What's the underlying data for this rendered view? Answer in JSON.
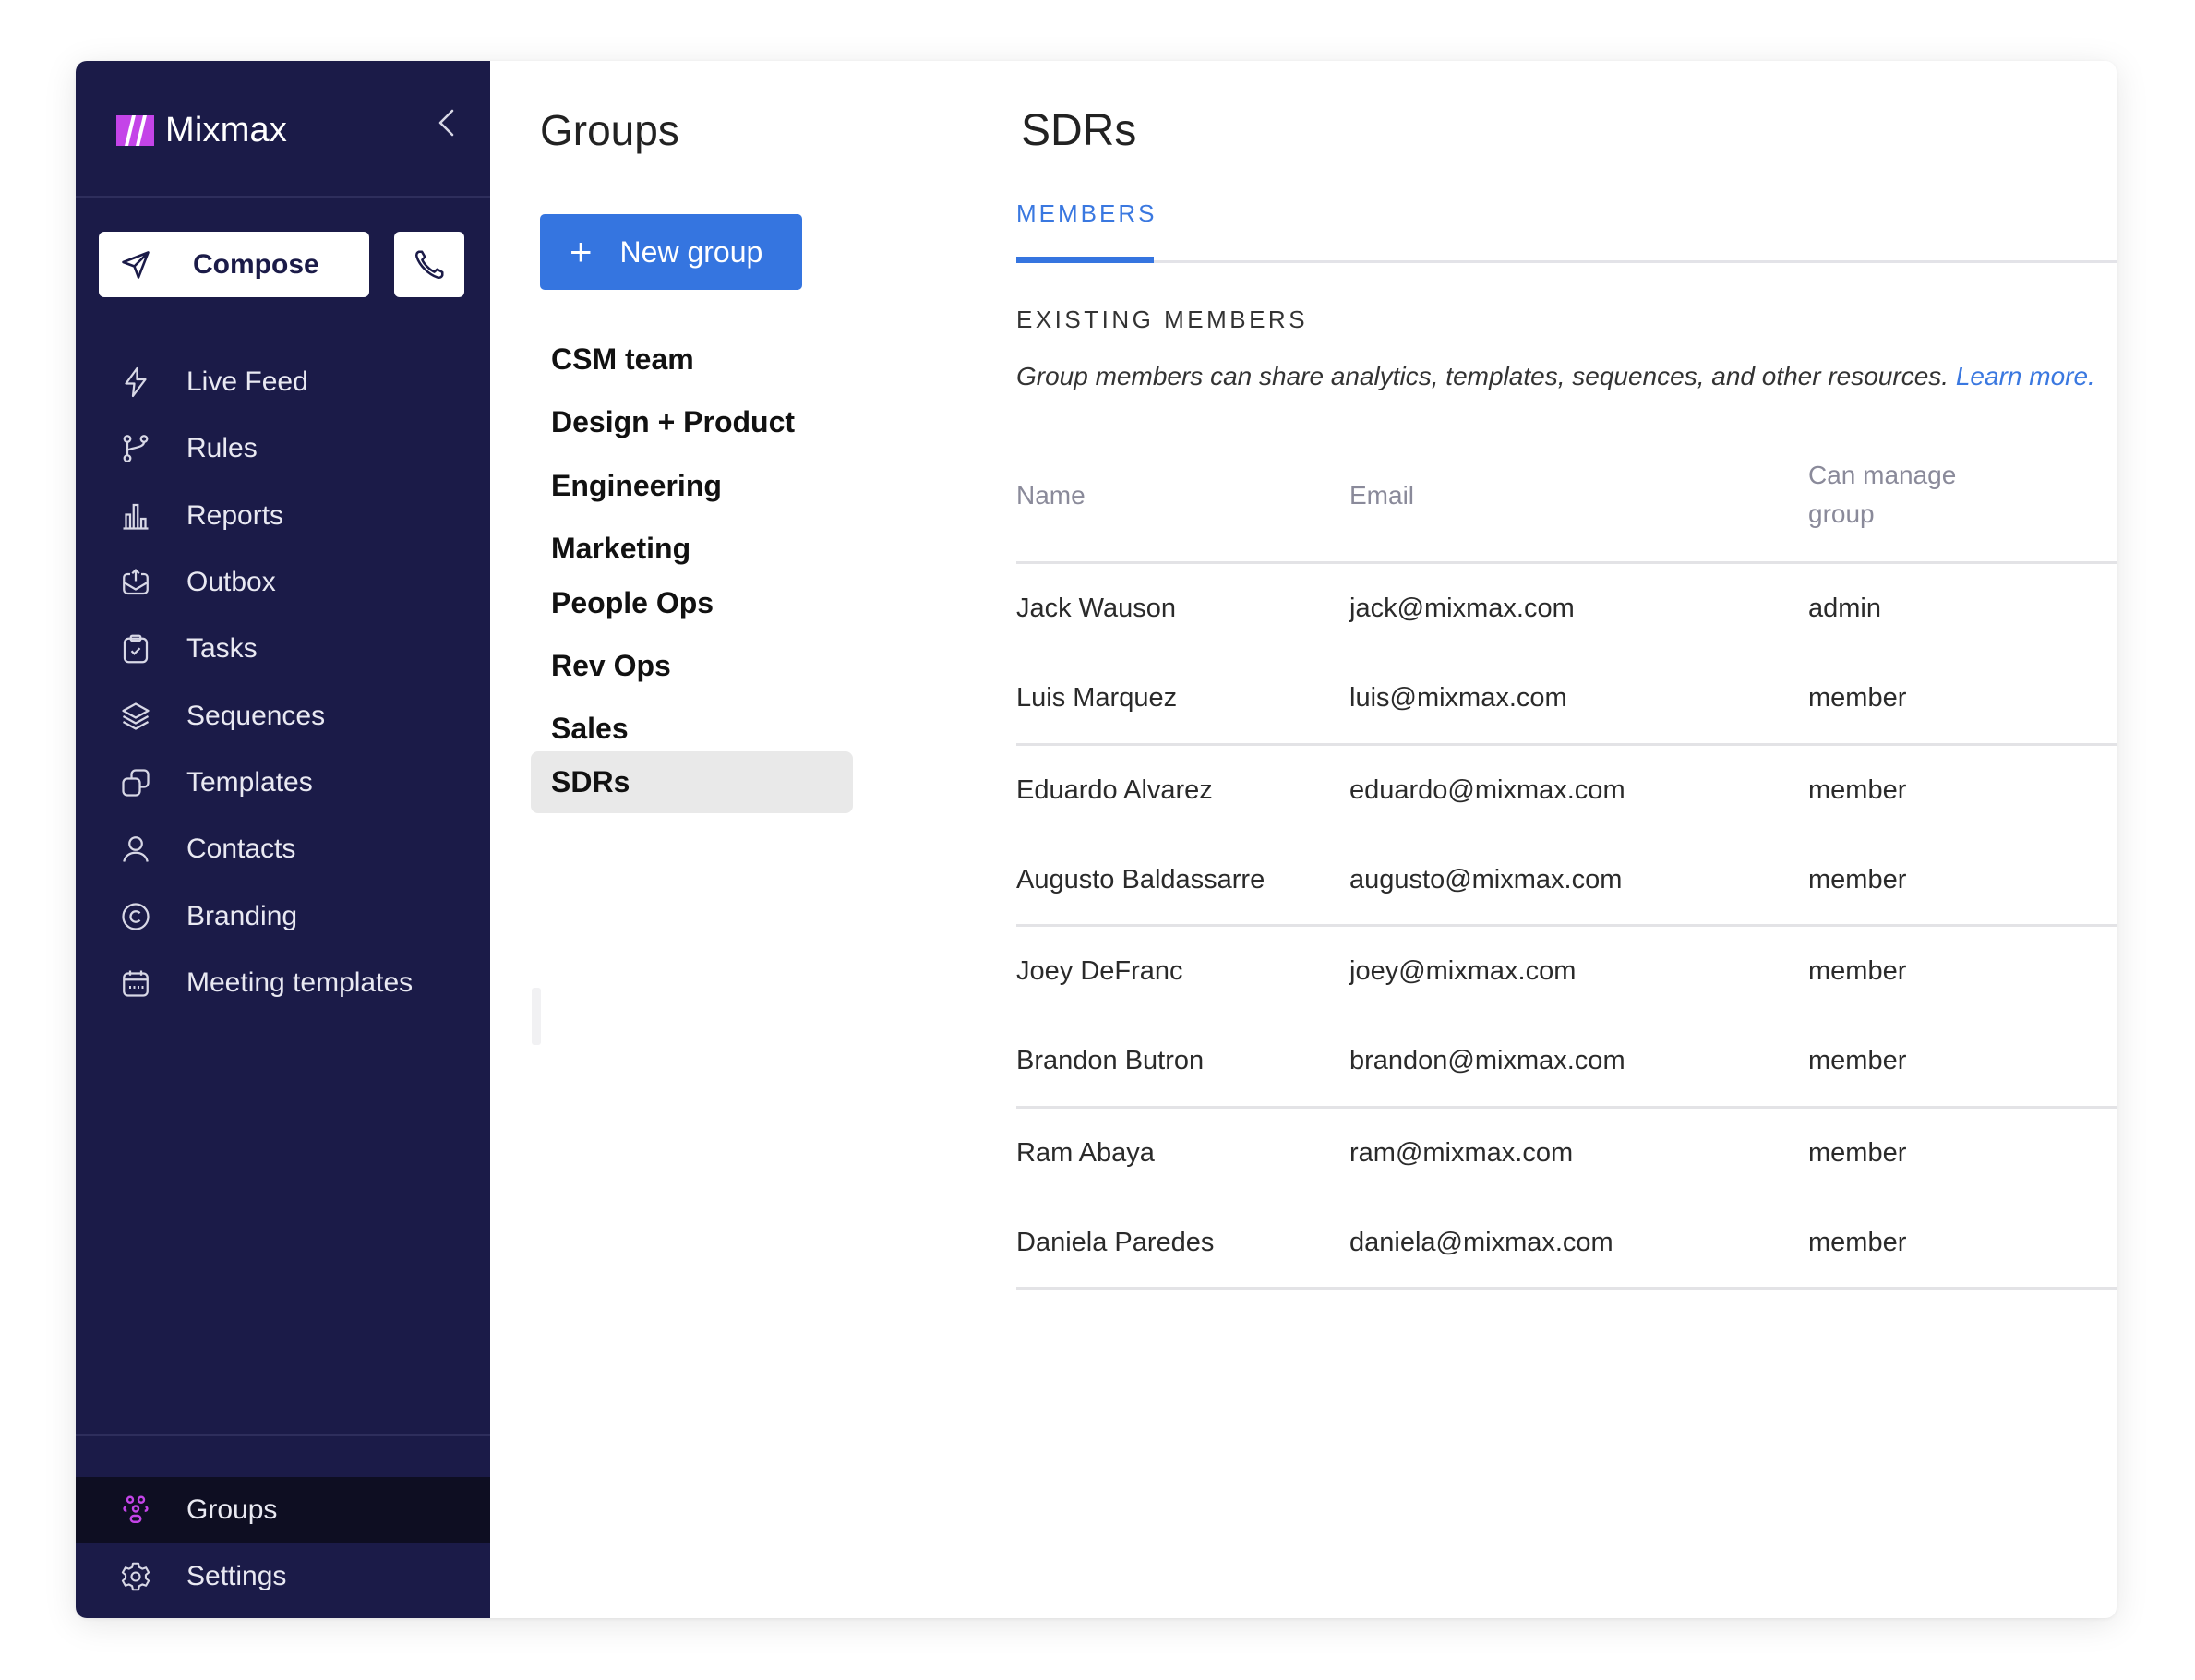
{
  "app": {
    "brand": "Mixmax",
    "colors": {
      "sidebar_bg": "#1b1b48",
      "sidebar_active_bg": "#0e0e22",
      "brand_purple": "#c444e8",
      "accent_blue": "#3575e0",
      "selected_group_bg": "#e9e9e9"
    }
  },
  "sidebar": {
    "collapse_icon": "chevron-left-icon",
    "compose": {
      "label": "Compose",
      "icon": "send-icon"
    },
    "phone": {
      "icon": "phone-icon"
    },
    "items": [
      {
        "label": "Live Feed",
        "icon": "lightning-icon"
      },
      {
        "label": "Rules",
        "icon": "branch-icon"
      },
      {
        "label": "Reports",
        "icon": "bar-chart-icon"
      },
      {
        "label": "Outbox",
        "icon": "outbox-icon"
      },
      {
        "label": "Tasks",
        "icon": "clipboard-check-icon"
      },
      {
        "label": "Sequences",
        "icon": "layers-icon"
      },
      {
        "label": "Templates",
        "icon": "copy-icon"
      },
      {
        "label": "Contacts",
        "icon": "person-icon"
      },
      {
        "label": "Branding",
        "icon": "copyright-icon"
      },
      {
        "label": "Meeting templates",
        "icon": "calendar-icon"
      }
    ],
    "bottom_items": [
      {
        "label": "Groups",
        "icon": "groups-icon",
        "active": true
      },
      {
        "label": "Settings",
        "icon": "gear-icon",
        "active": false
      }
    ]
  },
  "groups_panel": {
    "title": "Groups",
    "new_group_label": "New group",
    "groups": [
      "CSM team",
      "Design + Product",
      "Engineering",
      "Marketing",
      "People Ops",
      "Rev Ops",
      "Sales",
      "SDRs"
    ],
    "selected": "SDRs"
  },
  "detail": {
    "title": "SDRs",
    "tabs": [
      {
        "label": "MEMBERS",
        "active": true
      }
    ],
    "section_title": "EXISTING MEMBERS",
    "description": "Group members can share analytics, templates, sequences, and other resources.",
    "learn_more": "Learn more.",
    "table": {
      "headers": {
        "name": "Name",
        "email": "Email",
        "manage": "Can manage group"
      },
      "rows": [
        {
          "name": "Jack Wauson",
          "email": "jack@mixmax.com",
          "role": "admin"
        },
        {
          "name": "Luis Marquez",
          "email": "luis@mixmax.com",
          "role": "member"
        },
        {
          "name": "Eduardo Alvarez",
          "email": "eduardo@mixmax.com",
          "role": "member"
        },
        {
          "name": "Augusto Baldassarre",
          "email": "augusto@mixmax.com",
          "role": "member"
        },
        {
          "name": "Joey DeFranc",
          "email": "joey@mixmax.com",
          "role": "member"
        },
        {
          "name": "Brandon Butron",
          "email": "brandon@mixmax.com",
          "role": "member"
        },
        {
          "name": "Ram Abaya",
          "email": "ram@mixmax.com",
          "role": "member"
        },
        {
          "name": "Daniela Paredes",
          "email": "daniela@mixmax.com",
          "role": "member"
        }
      ]
    }
  }
}
